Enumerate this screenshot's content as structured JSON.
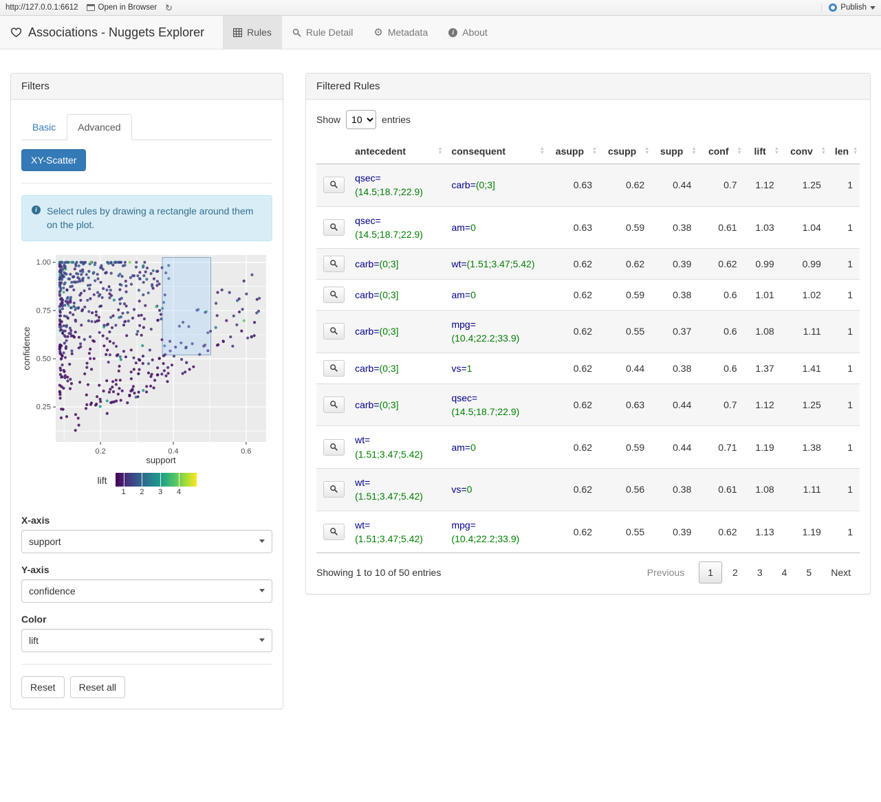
{
  "viewer_bar": {
    "url": "http://127.0.0.1:6612",
    "open_in_browser_label": "Open in Browser",
    "publish_label": "Publish"
  },
  "navbar": {
    "brand": "Associations - Nuggets Explorer",
    "tabs": [
      {
        "label": "Rules",
        "icon": "table-icon",
        "active": true
      },
      {
        "label": "Rule Detail",
        "icon": "search-icon",
        "active": false
      },
      {
        "label": "Metadata",
        "icon": "gear-icon",
        "active": false
      },
      {
        "label": "About",
        "icon": "info-icon",
        "active": false
      }
    ]
  },
  "filters": {
    "title": "Filters",
    "tabs": [
      {
        "label": "Basic",
        "active": false
      },
      {
        "label": "Advanced",
        "active": true
      }
    ],
    "scatter_button_label": "XY-Scatter",
    "info_text": "Select rules by drawing a rectangle around them on the plot.",
    "x_axis": {
      "label": "X-axis",
      "value": "support"
    },
    "y_axis": {
      "label": "Y-axis",
      "value": "confidence"
    },
    "color": {
      "label": "Color",
      "value": "lift"
    },
    "reset_label": "Reset",
    "reset_all_label": "Reset all"
  },
  "chart_data": {
    "type": "scatter",
    "xlabel": "support",
    "ylabel": "confidence",
    "xlim": [
      0.077,
      0.655
    ],
    "ylim": [
      0.069,
      1.038
    ],
    "x_ticks": [
      "0.2",
      "0.4",
      "0.6"
    ],
    "y_ticks": [
      "0.25",
      "0.50",
      "0.75",
      "1.00"
    ],
    "minor_x": [
      0.1,
      0.3,
      0.5
    ],
    "minor_y": [
      0.125,
      0.375,
      0.625,
      0.875
    ],
    "grid": true,
    "panel_color": "#ebebeb",
    "legend": {
      "label": "lift",
      "ticks": [
        "1",
        "2",
        "3",
        "4"
      ],
      "domain": [
        0.55,
        4.95
      ],
      "position": "bottom"
    },
    "palette": [
      "#440154",
      "#46327e",
      "#365c8d",
      "#277f8e",
      "#1fa187",
      "#4ac16d",
      "#a0da39",
      "#fde725"
    ],
    "selection_rect": {
      "x0": 0.37,
      "x1": 0.503,
      "y0": 0.52,
      "y1": 1.025
    },
    "points_spec": {
      "seed": 123,
      "n_cloud": 430,
      "n_top": 35,
      "streak_antecedent_supports": [
        1.0,
        0.91,
        0.85,
        0.78,
        0.72,
        0.66,
        0.62
      ]
    }
  },
  "rules_panel": {
    "title": "Filtered Rules",
    "show_label": "Show",
    "entries_label": "entries",
    "page_length": "10",
    "attr_color": "#00008b",
    "val_color": "#008000",
    "columns": [
      "antecedent",
      "consequent",
      "asupp",
      "csupp",
      "supp",
      "conf",
      "lift",
      "conv",
      "len"
    ],
    "rows": [
      {
        "antecedent": {
          "attr": "qsec=",
          "val": "(14.5;18.7;22.9)"
        },
        "consequent": {
          "attr": "carb=",
          "val": "(0;3]"
        },
        "asupp": "0.63",
        "csupp": "0.62",
        "supp": "0.44",
        "conf": "0.7",
        "lift": "1.12",
        "conv": "1.25",
        "len": "1"
      },
      {
        "antecedent": {
          "attr": "qsec=",
          "val": "(14.5;18.7;22.9)"
        },
        "consequent": {
          "attr": "am=",
          "val": "0"
        },
        "asupp": "0.63",
        "csupp": "0.59",
        "supp": "0.38",
        "conf": "0.61",
        "lift": "1.03",
        "conv": "1.04",
        "len": "1"
      },
      {
        "antecedent": {
          "attr": "carb=",
          "val": "(0;3]"
        },
        "consequent": {
          "attr": "wt=",
          "val": "(1.51;3.47;5.42)"
        },
        "asupp": "0.62",
        "csupp": "0.62",
        "supp": "0.39",
        "conf": "0.62",
        "lift": "0.99",
        "conv": "0.99",
        "len": "1"
      },
      {
        "antecedent": {
          "attr": "carb=",
          "val": "(0;3]"
        },
        "consequent": {
          "attr": "am=",
          "val": "0"
        },
        "asupp": "0.62",
        "csupp": "0.59",
        "supp": "0.38",
        "conf": "0.6",
        "lift": "1.01",
        "conv": "1.02",
        "len": "1"
      },
      {
        "antecedent": {
          "attr": "carb=",
          "val": "(0;3]"
        },
        "consequent": {
          "attr": "mpg=",
          "val": "(10.4;22.2;33.9)"
        },
        "asupp": "0.62",
        "csupp": "0.55",
        "supp": "0.37",
        "conf": "0.6",
        "lift": "1.08",
        "conv": "1.11",
        "len": "1"
      },
      {
        "antecedent": {
          "attr": "carb=",
          "val": "(0;3]"
        },
        "consequent": {
          "attr": "vs=",
          "val": "1"
        },
        "asupp": "0.62",
        "csupp": "0.44",
        "supp": "0.38",
        "conf": "0.6",
        "lift": "1.37",
        "conv": "1.41",
        "len": "1"
      },
      {
        "antecedent": {
          "attr": "carb=",
          "val": "(0;3]"
        },
        "consequent": {
          "attr": "qsec=",
          "val": "(14.5;18.7;22.9)"
        },
        "asupp": "0.62",
        "csupp": "0.63",
        "supp": "0.44",
        "conf": "0.7",
        "lift": "1.12",
        "conv": "1.25",
        "len": "1"
      },
      {
        "antecedent": {
          "attr": "wt=",
          "val": "(1.51;3.47;5.42)"
        },
        "consequent": {
          "attr": "am=",
          "val": "0"
        },
        "asupp": "0.62",
        "csupp": "0.59",
        "supp": "0.44",
        "conf": "0.71",
        "lift": "1.19",
        "conv": "1.38",
        "len": "1"
      },
      {
        "antecedent": {
          "attr": "wt=",
          "val": "(1.51;3.47;5.42)"
        },
        "consequent": {
          "attr": "vs=",
          "val": "0"
        },
        "asupp": "0.62",
        "csupp": "0.56",
        "supp": "0.38",
        "conf": "0.61",
        "lift": "1.08",
        "conv": "1.11",
        "len": "1"
      },
      {
        "antecedent": {
          "attr": "wt=",
          "val": "(1.51;3.47;5.42)"
        },
        "consequent": {
          "attr": "mpg=",
          "val": "(10.4;22.2;33.9)"
        },
        "asupp": "0.62",
        "csupp": "0.55",
        "supp": "0.39",
        "conf": "0.62",
        "lift": "1.13",
        "conv": "1.19",
        "len": "1"
      }
    ],
    "info": "Showing 1 to 10 of 50 entries",
    "pagination": {
      "previous": "Previous",
      "pages": [
        "1",
        "2",
        "3",
        "4",
        "5"
      ],
      "active_page": "1",
      "next": "Next"
    }
  }
}
